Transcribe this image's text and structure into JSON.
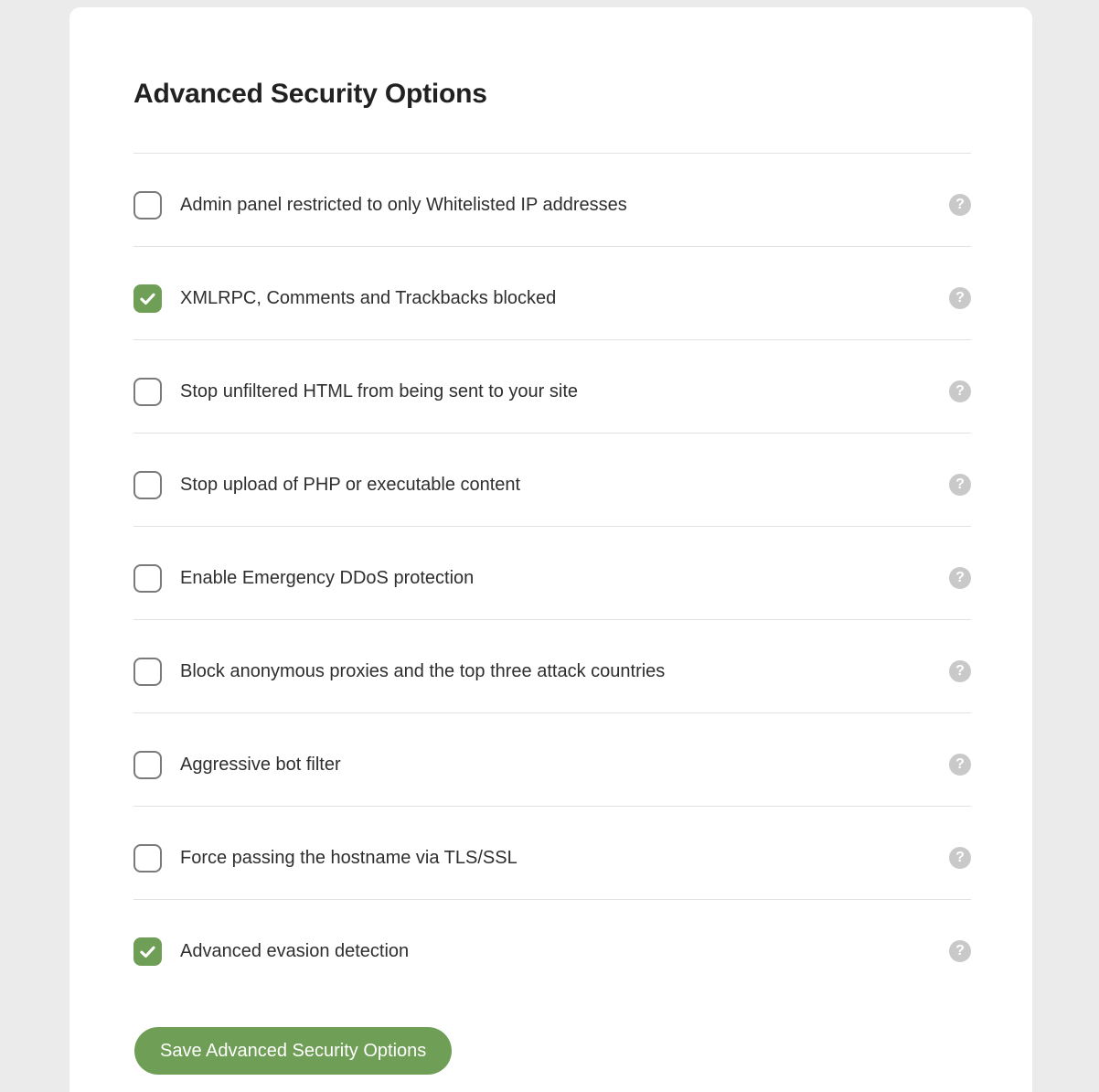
{
  "page": {
    "background_color": "#ebebeb",
    "card_background": "#ffffff"
  },
  "header": {
    "title": "Advanced Security Options"
  },
  "colors": {
    "accent_green": "#6f9e56",
    "divider": "#e2e2e2",
    "help_icon_background": "#c9c9c9",
    "checkbox_border": "#7a7a7a",
    "label_text": "#2e2e2e",
    "title_text": "#212121"
  },
  "options": [
    {
      "label": "Admin panel restricted to only Whitelisted IP addresses",
      "checked": false,
      "help_icon": "question-mark-icon",
      "help_glyph": "?"
    },
    {
      "label": "XMLRPC, Comments and Trackbacks blocked",
      "checked": true,
      "help_icon": "question-mark-icon",
      "help_glyph": "?"
    },
    {
      "label": "Stop unfiltered HTML from being sent to your site",
      "checked": false,
      "help_icon": "question-mark-icon",
      "help_glyph": "?"
    },
    {
      "label": "Stop upload of PHP or executable content",
      "checked": false,
      "help_icon": "question-mark-icon",
      "help_glyph": "?"
    },
    {
      "label": "Enable Emergency DDoS protection",
      "checked": false,
      "help_icon": "question-mark-icon",
      "help_glyph": "?"
    },
    {
      "label": "Block anonymous proxies and the top three attack countries",
      "checked": false,
      "help_icon": "question-mark-icon",
      "help_glyph": "?"
    },
    {
      "label": "Aggressive bot filter",
      "checked": false,
      "help_icon": "question-mark-icon",
      "help_glyph": "?"
    },
    {
      "label": "Force passing the hostname via TLS/SSL",
      "checked": false,
      "help_icon": "question-mark-icon",
      "help_glyph": "?"
    },
    {
      "label": "Advanced evasion detection",
      "checked": true,
      "help_icon": "question-mark-icon",
      "help_glyph": "?"
    }
  ],
  "footer": {
    "save_label": "Save Advanced Security Options"
  }
}
